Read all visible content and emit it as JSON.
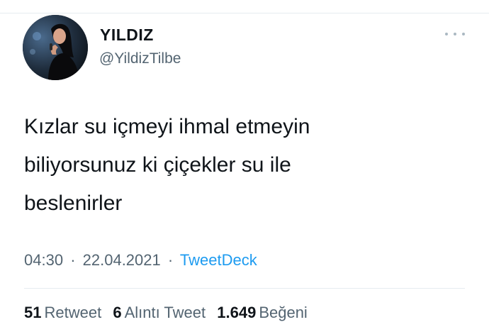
{
  "tweet": {
    "author": {
      "display_name": "YILDIZ",
      "handle": "@YildizTilbe"
    },
    "text": "Kızlar su içmeyi ihmal etmeyin\nbiliyorsunuz ki çiçekler su ile\nbeslenirler",
    "time": "04:30",
    "separator": "·",
    "date": "22.04.2021",
    "source": "TweetDeck",
    "stats": {
      "retweets_count": "51",
      "retweets_label": "Retweet",
      "quotes_count": "6",
      "quotes_label": "Alıntı Tweet",
      "likes_count": "1.649",
      "likes_label": "Beğeni"
    }
  },
  "icons": {
    "more": "more-horizontal-icon",
    "avatar": "profile-photo"
  },
  "colors": {
    "text_primary": "#0f1419",
    "text_secondary": "#536471",
    "link": "#1d9bf0",
    "divider": "#e6ecf0"
  }
}
